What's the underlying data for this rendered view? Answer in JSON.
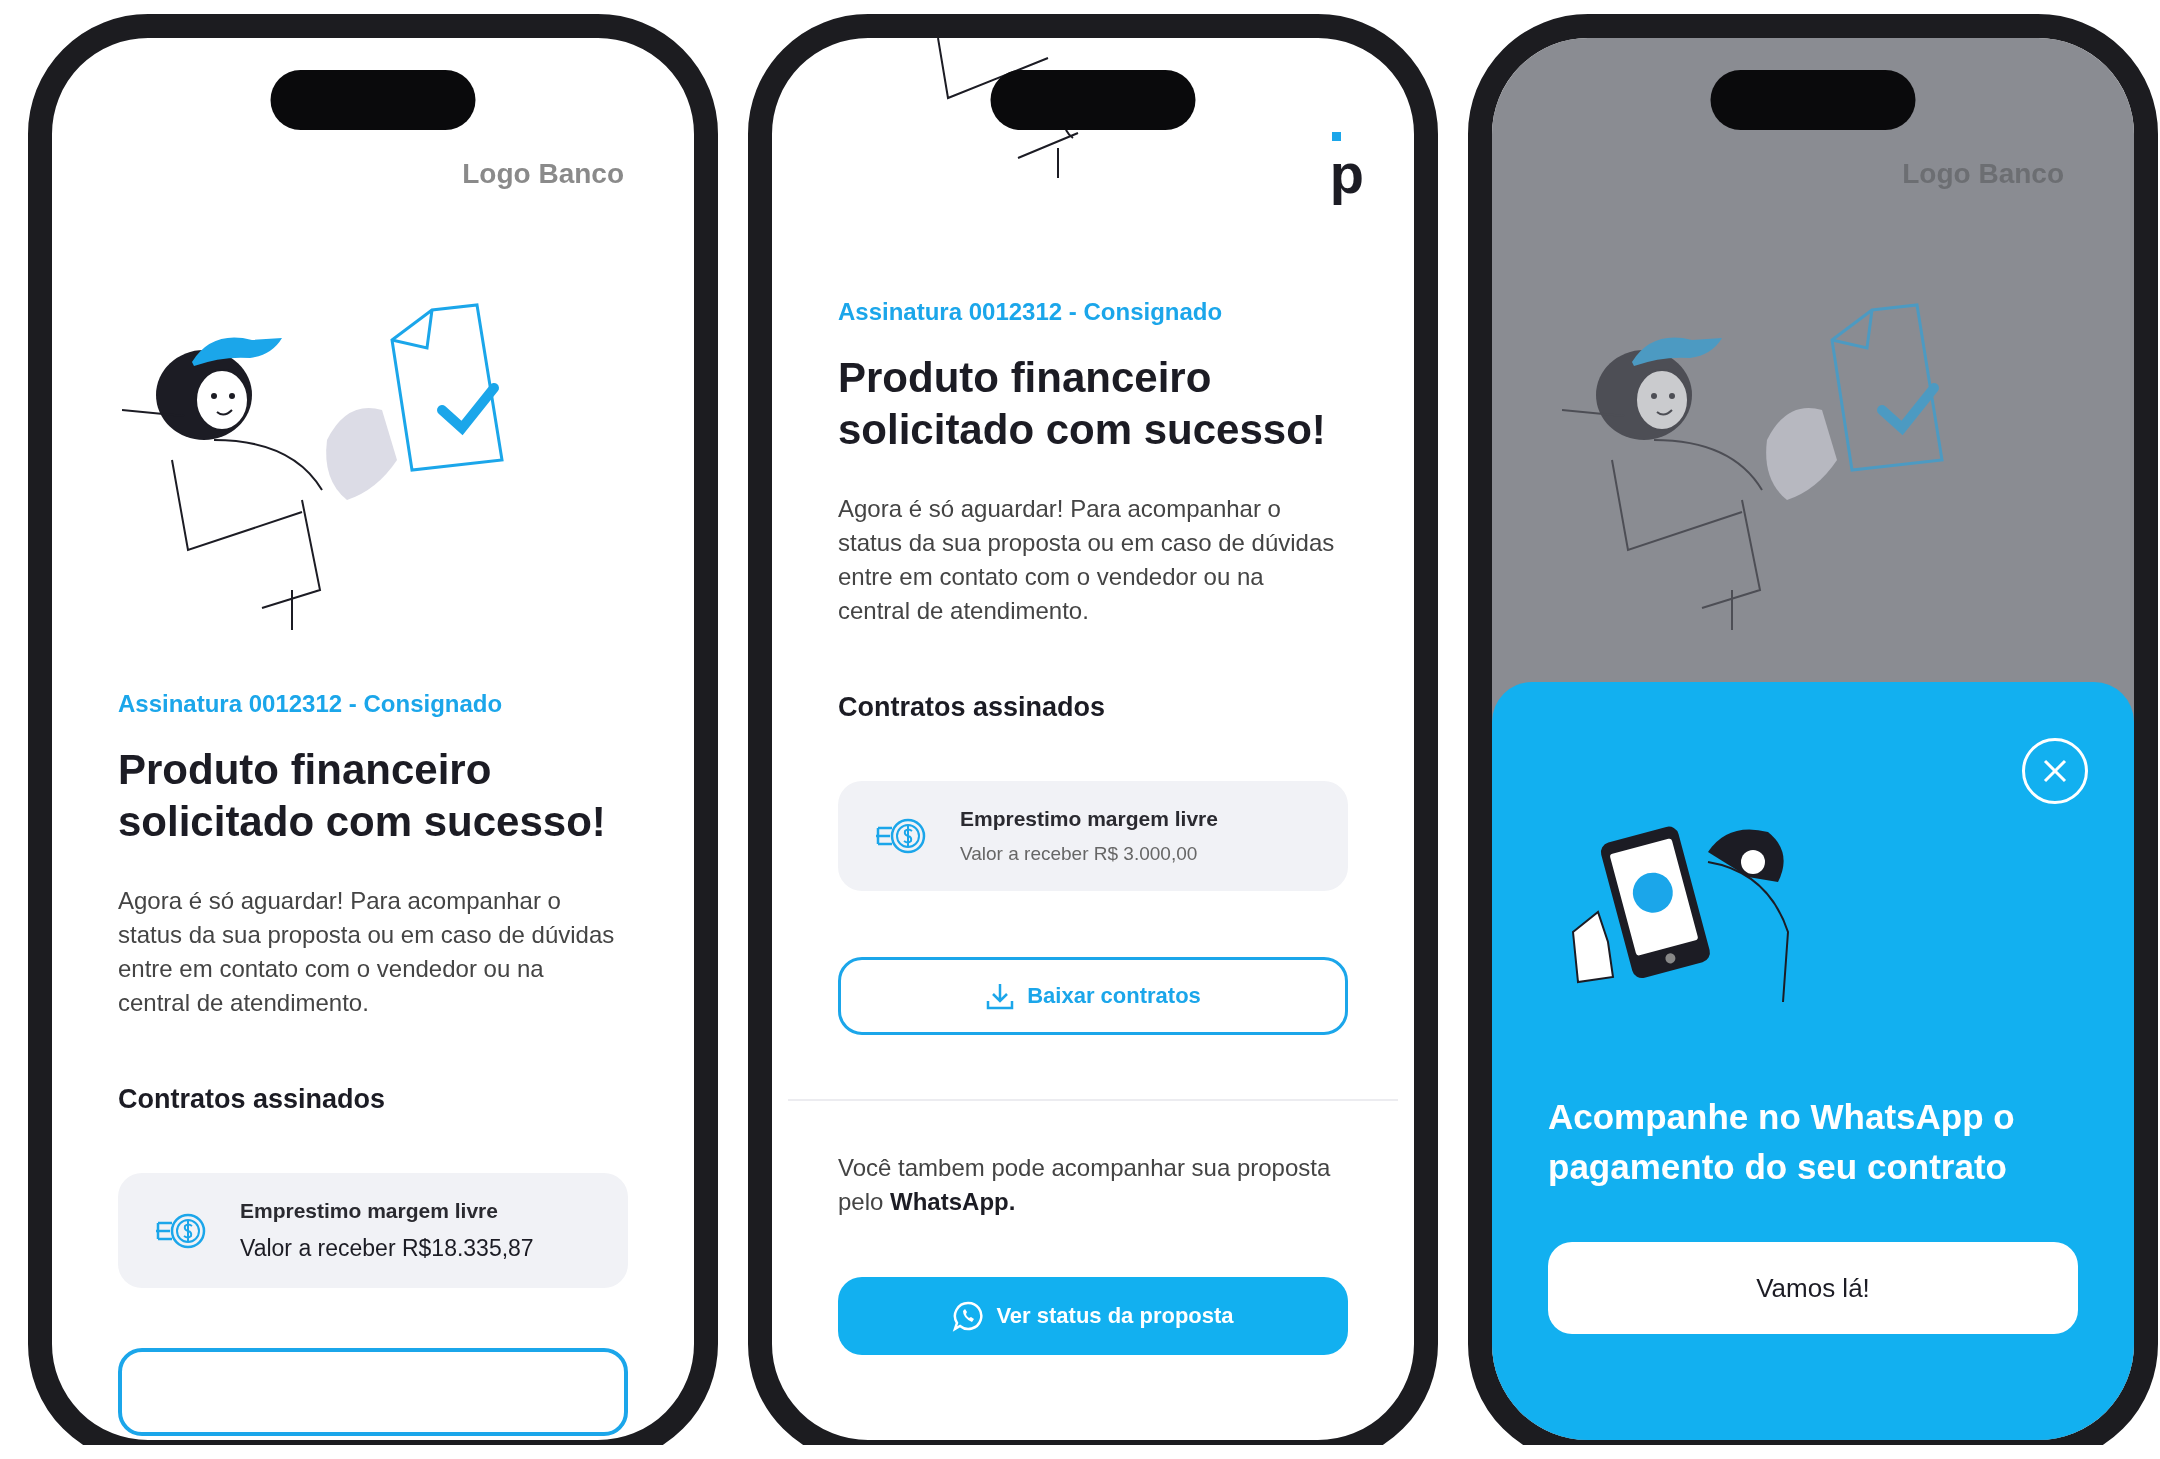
{
  "phones": [
    {
      "kind": "detail",
      "logo": "Logo Banco",
      "eyebrow": "Assinatura 0012312 - Consignado",
      "title_lines": [
        "Produto financeiro",
        "solicitado com sucesso!"
      ],
      "body": "Agora é só aguardar! Para acompanhar o status da sua proposta ou em caso de dúvidas entre em contato com o vendedor ou na central de atendimento.",
      "section": "Contratos assinados",
      "contract": {
        "name": "Emprestimo margem livre",
        "value": "Valor a receber R$18.335,87"
      }
    },
    {
      "kind": "detail-scrolled",
      "logo": "p",
      "eyebrow": "Assinatura 0012312 - Consignado",
      "title_lines": [
        "Produto financeiro",
        "solicitado com sucesso!"
      ],
      "body": "Agora é só aguardar! Para acompanhar o status da sua proposta ou em caso de dúvidas entre em contato com o vendedor ou na central de atendimento.",
      "section": "Contratos assinados",
      "contract": {
        "name": "Emprestimo margem livre",
        "value": "Valor a receber R$ 3.000,00"
      },
      "download_button": "Baixar contratos",
      "note": "Você tambem pode acompanhar sua proposta pelo **WhatsApp.**",
      "primary_button": "Ver status da proposta"
    },
    {
      "kind": "sheet",
      "logo": "Logo Banco",
      "sheet": {
        "title_lines": [
          "Acompanhe no WhatsApp o",
          "pagamento do seu contrato"
        ],
        "button": "Vamos lá!"
      }
    }
  ]
}
